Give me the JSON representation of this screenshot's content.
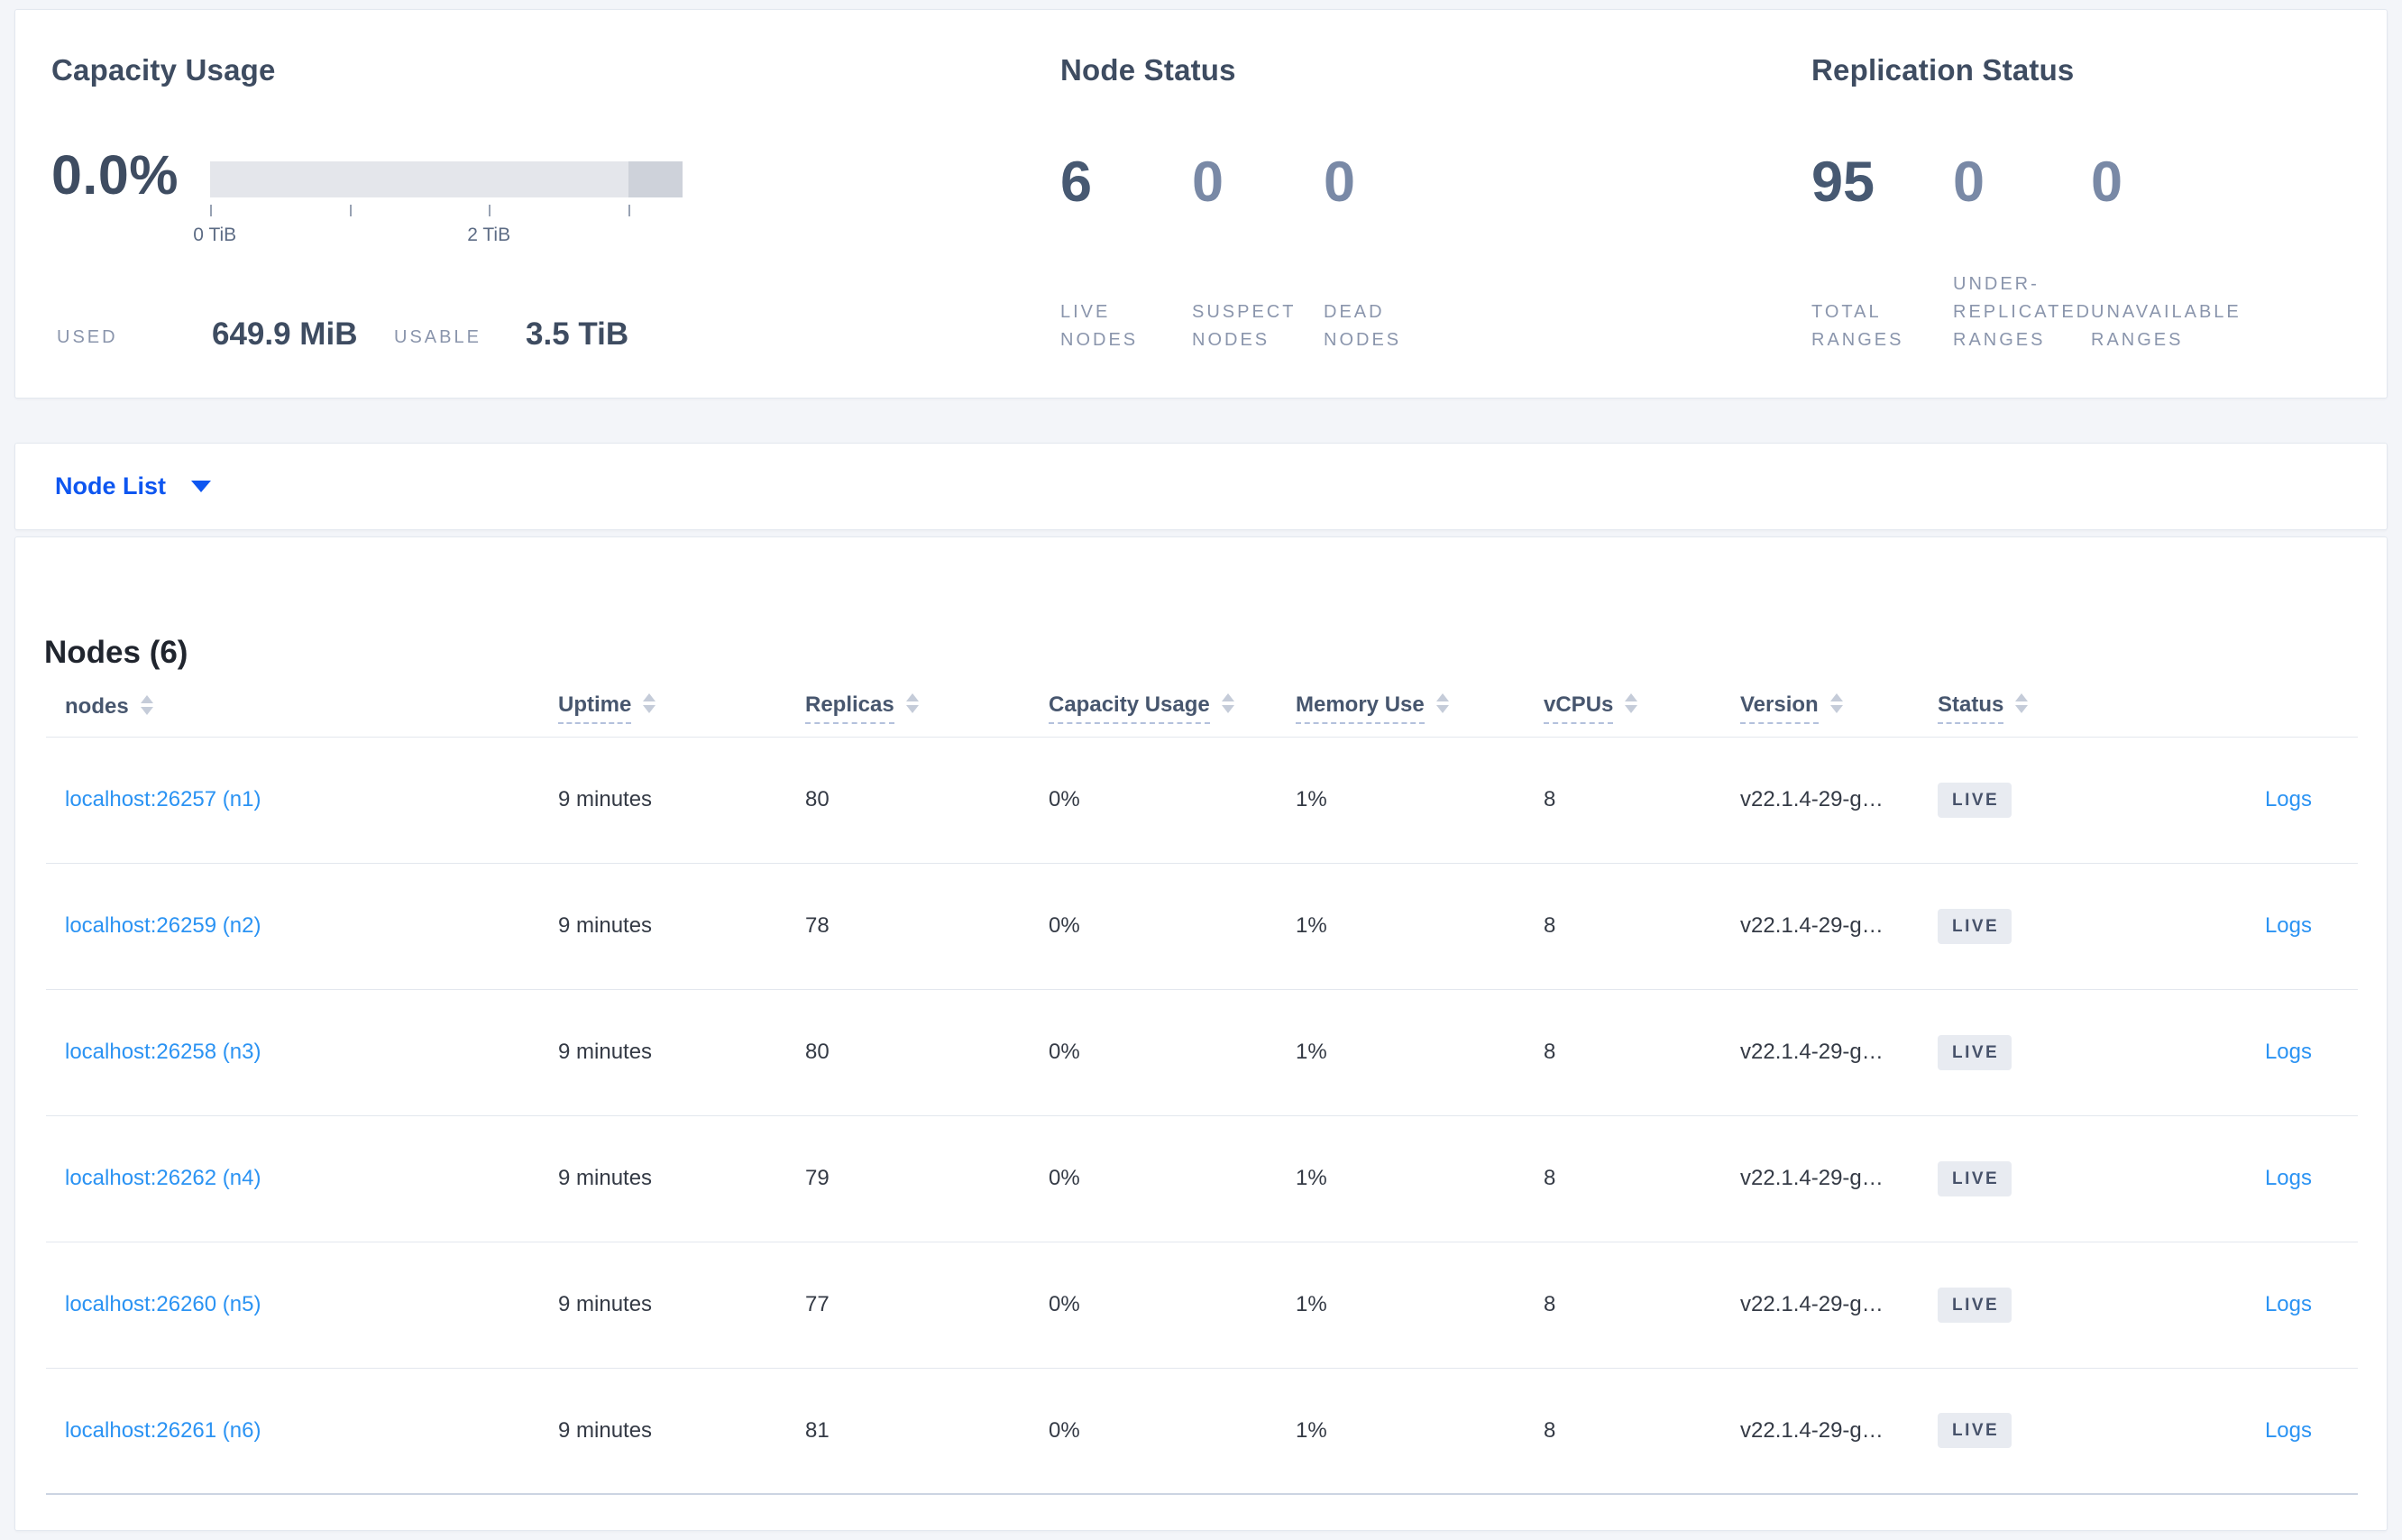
{
  "overview": {
    "capacity": {
      "title": "Capacity Usage",
      "percent": "0.0%",
      "ticks": [
        "0 TiB",
        "2 TiB"
      ],
      "used_label": "USED",
      "used_value": "649.9 MiB",
      "usable_label": "USABLE",
      "usable_value": "3.5 TiB"
    },
    "node_status": {
      "title": "Node Status",
      "stats": [
        {
          "value": "6",
          "label": "LIVE NODES",
          "emphasis": true
        },
        {
          "value": "0",
          "label": "SUSPECT NODES",
          "emphasis": false
        },
        {
          "value": "0",
          "label": "DEAD NODES",
          "emphasis": false
        }
      ]
    },
    "replication_status": {
      "title": "Replication Status",
      "stats": [
        {
          "value": "95",
          "label": "TOTAL RANGES",
          "emphasis": true
        },
        {
          "value": "0",
          "label": "UNDER-REPLICATED RANGES",
          "emphasis": false
        },
        {
          "value": "0",
          "label": "UNAVAILABLE RANGES",
          "emphasis": false
        }
      ]
    }
  },
  "view_selector": {
    "label": "Node List"
  },
  "nodes_table": {
    "title": "Nodes (6)",
    "columns": [
      {
        "label": "nodes",
        "sortable": true,
        "tooltip": false
      },
      {
        "label": "Uptime",
        "sortable": true,
        "tooltip": true
      },
      {
        "label": "Replicas",
        "sortable": true,
        "tooltip": true
      },
      {
        "label": "Capacity Usage",
        "sortable": true,
        "tooltip": true
      },
      {
        "label": "Memory Use",
        "sortable": true,
        "tooltip": true
      },
      {
        "label": "vCPUs",
        "sortable": true,
        "tooltip": true
      },
      {
        "label": "Version",
        "sortable": true,
        "tooltip": true
      },
      {
        "label": "Status",
        "sortable": true,
        "tooltip": true
      },
      {
        "label": "",
        "sortable": false,
        "tooltip": false
      }
    ],
    "rows": [
      {
        "node": "localhost:26257 (n1)",
        "uptime": "9 minutes",
        "replicas": "80",
        "capacity_usage": "0%",
        "memory_use": "1%",
        "vcpus": "8",
        "version": "v22.1.4-29-g…",
        "status": "LIVE",
        "logs_label": "Logs"
      },
      {
        "node": "localhost:26259 (n2)",
        "uptime": "9 minutes",
        "replicas": "78",
        "capacity_usage": "0%",
        "memory_use": "1%",
        "vcpus": "8",
        "version": "v22.1.4-29-g…",
        "status": "LIVE",
        "logs_label": "Logs"
      },
      {
        "node": "localhost:26258 (n3)",
        "uptime": "9 minutes",
        "replicas": "80",
        "capacity_usage": "0%",
        "memory_use": "1%",
        "vcpus": "8",
        "version": "v22.1.4-29-g…",
        "status": "LIVE",
        "logs_label": "Logs"
      },
      {
        "node": "localhost:26262 (n4)",
        "uptime": "9 minutes",
        "replicas": "79",
        "capacity_usage": "0%",
        "memory_use": "1%",
        "vcpus": "8",
        "version": "v22.1.4-29-g…",
        "status": "LIVE",
        "logs_label": "Logs"
      },
      {
        "node": "localhost:26260 (n5)",
        "uptime": "9 minutes",
        "replicas": "77",
        "capacity_usage": "0%",
        "memory_use": "1%",
        "vcpus": "8",
        "version": "v22.1.4-29-g…",
        "status": "LIVE",
        "logs_label": "Logs"
      },
      {
        "node": "localhost:26261 (n6)",
        "uptime": "9 minutes",
        "replicas": "81",
        "capacity_usage": "0%",
        "memory_use": "1%",
        "vcpus": "8",
        "version": "v22.1.4-29-g…",
        "status": "LIVE",
        "logs_label": "Logs"
      }
    ]
  },
  "colors": {
    "page_background": "#f3f5f9",
    "card_border": "#e3e8ef",
    "heading_slate": "#3e4c61",
    "stat_emphasis": "#475972",
    "stat_dim": "#7989a6",
    "stat_label_gray": "#8a95ac",
    "table_link_blue": "#2b93f3",
    "selector_blue": "#0e56f0",
    "badge_background": "#e8ebf1",
    "badge_text": "#47526a",
    "bar_track": "#e4e6eb",
    "bar_reserved": "#ced2da"
  }
}
